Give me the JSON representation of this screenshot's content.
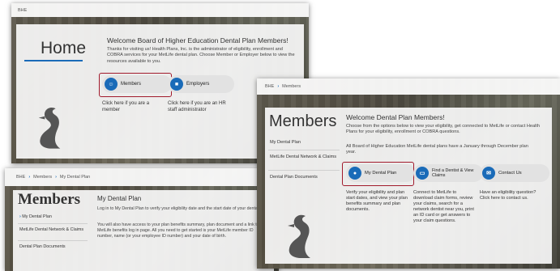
{
  "home": {
    "breadcrumb": "BHE",
    "title": "Home",
    "heading": "Welcome Board of Higher Education Dental Plan Members!",
    "intro": "Thanks for visiting us! Health Plans, Inc. is the administrator of eligibility, enrollment and COBRA services for your MetLife dental plan. Choose Member or Employer below to view the resources available to you.",
    "members_label": "Members",
    "members_desc": "Click here if you are a member",
    "employers_label": "Employers",
    "employers_desc": "Click here if you are an HR staff administrator"
  },
  "members": {
    "breadcrumb_home": "BHE",
    "breadcrumb_current": "Members",
    "title": "Members",
    "sidebar": [
      "My Dental Plan",
      "MetLife Dental Network & Claims",
      "Dental Plan Documents"
    ],
    "heading": "Welcome Dental Plan Members!",
    "intro": "Choose from the options below to view your eligibility, get connected to MetLife or contact Health Plans for your eligibility, enrollment or COBRA questions.",
    "note": "All Board of Higher Education MetLife dental plans have a January through December plan year.",
    "tiles": [
      {
        "label": "My Dental Plan",
        "desc": "Verify your eligibility and plan start dates, and view your plan benefits summary and plan documents."
      },
      {
        "label": "Find a Dentist & View Claims",
        "desc": "Connect to MetLife to download claim forms, review your claims, search for a network dentist near you, print an ID card or get answers to your claim questions."
      },
      {
        "label": "Contact Us",
        "desc": "Have an eligibility question? Click here to contact us."
      }
    ]
  },
  "plan": {
    "breadcrumb_home": "BHE",
    "breadcrumb_members": "Members",
    "breadcrumb_current": "My Dental Plan",
    "title": "Members",
    "sidebar_active": "My Dental Plan",
    "sidebar": [
      "MetLife Dental Network & Claims",
      "Dental Plan Documents"
    ],
    "heading": "My Dental Plan",
    "p1": "Log in to My Dental Plan to verify your eligibility date and the start date of your dental plan.",
    "p2": "You will also have access to your plan benefits summary, plan document and a link to your MetLife benefits log in page. All you need to get started is your MetLife member ID number, name (or your employee ID number) and your date of birth."
  },
  "colors": {
    "accent": "#1a6bb8",
    "highlight": "#a11a2c"
  }
}
